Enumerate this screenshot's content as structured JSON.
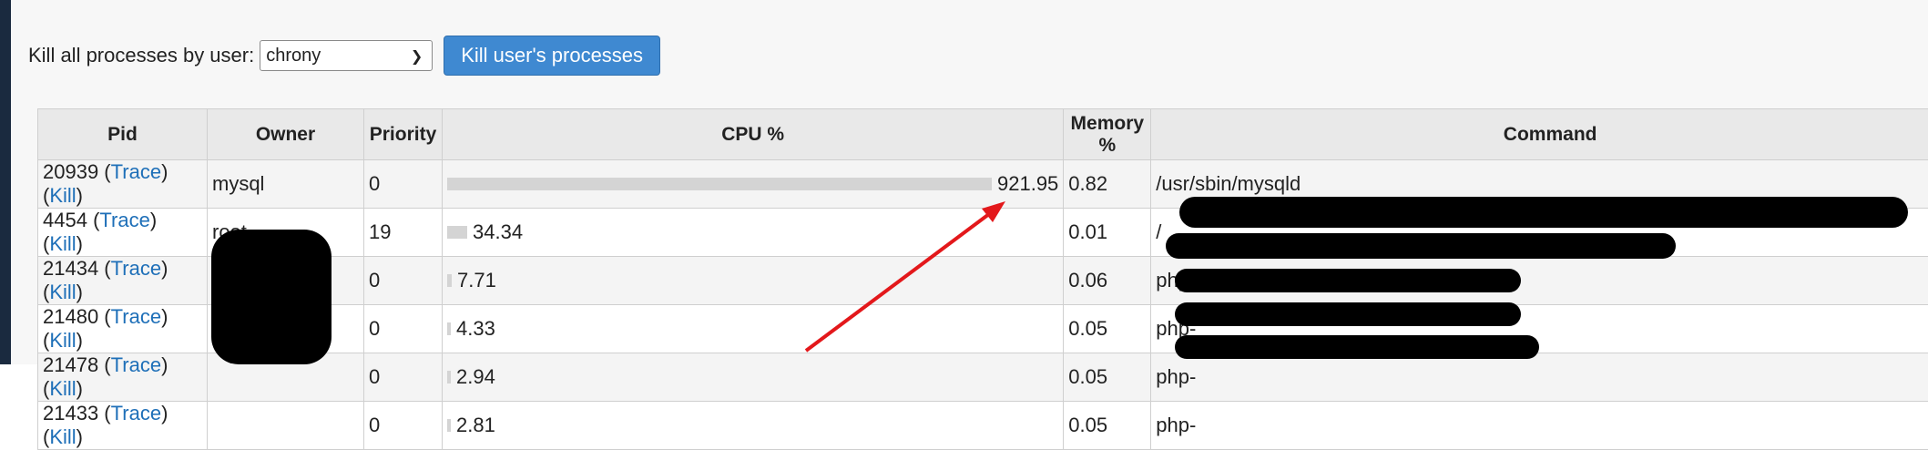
{
  "kill_section": {
    "label": "Kill all processes by user:",
    "selected_user": "chrony",
    "button_label": "Kill user's processes"
  },
  "table": {
    "headers": {
      "pid": "Pid",
      "owner": "Owner",
      "priority": "Priority",
      "cpu": "CPU %",
      "memory": "Memory %",
      "command": "Command"
    },
    "trace_label": "Trace",
    "kill_label": "Kill",
    "rows": [
      {
        "pid": "20939",
        "owner": "mysql",
        "priority": "0",
        "cpu": "921.95",
        "cpu_fraction": 1.0,
        "memory": "0.82",
        "command": "/usr/sbin/mysqld"
      },
      {
        "pid": "4454",
        "owner": "root",
        "priority": "19",
        "cpu": "34.34",
        "cpu_fraction": 0.037,
        "memory": "0.01",
        "command": "/"
      },
      {
        "pid": "21434",
        "owner": "",
        "priority": "0",
        "cpu": "7.71",
        "cpu_fraction": 0.008,
        "memory": "0.06",
        "command": "php-"
      },
      {
        "pid": "21480",
        "owner": "",
        "priority": "0",
        "cpu": "4.33",
        "cpu_fraction": 0.0047,
        "memory": "0.05",
        "command": "php-"
      },
      {
        "pid": "21478",
        "owner": "",
        "priority": "0",
        "cpu": "2.94",
        "cpu_fraction": 0.0032,
        "memory": "0.05",
        "command": "php-"
      },
      {
        "pid": "21433",
        "owner": "",
        "priority": "0",
        "cpu": "2.81",
        "cpu_fraction": 0.003,
        "memory": "0.05",
        "command": "php-"
      }
    ]
  },
  "colors": {
    "link": "#1e6fb8",
    "button": "#3f89d1",
    "annotation_arrow": "#e3181b",
    "redaction": "#000000"
  }
}
